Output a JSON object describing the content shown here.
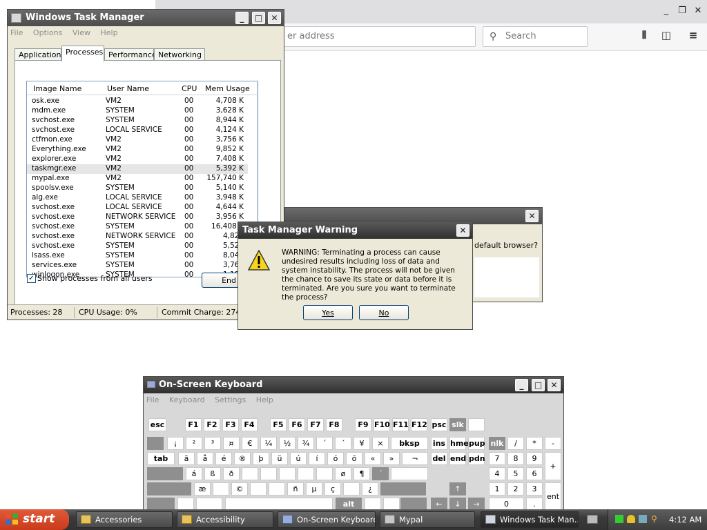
{
  "browser": {
    "url_placeholder": "er address",
    "search_placeholder": "Search"
  },
  "taskmanager": {
    "title": "Windows Task Manager",
    "menu": [
      "File",
      "Options",
      "View",
      "Help"
    ],
    "tabs": [
      "Applications",
      "Processes",
      "Performance",
      "Networking"
    ],
    "selected_tab": "Processes",
    "columns": [
      "Image Name",
      "User Name",
      "CPU",
      "Mem Usage"
    ],
    "processes": [
      [
        "osk.exe",
        "VM2",
        "00",
        "4,708 K"
      ],
      [
        "mdm.exe",
        "SYSTEM",
        "00",
        "3,628 K"
      ],
      [
        "svchost.exe",
        "SYSTEM",
        "00",
        "8,944 K"
      ],
      [
        "svchost.exe",
        "LOCAL SERVICE",
        "00",
        "4,124 K"
      ],
      [
        "ctfmon.exe",
        "VM2",
        "00",
        "3,756 K"
      ],
      [
        "Everything.exe",
        "VM2",
        "00",
        "9,852 K"
      ],
      [
        "explorer.exe",
        "VM2",
        "00",
        "7,408 K"
      ],
      [
        "taskmgr.exe",
        "VM2",
        "00",
        "5,392 K"
      ],
      [
        "mypal.exe",
        "VM2",
        "00",
        "157,740 K"
      ],
      [
        "spoolsv.exe",
        "SYSTEM",
        "00",
        "5,140 K"
      ],
      [
        "alg.exe",
        "LOCAL SERVICE",
        "00",
        "3,948 K"
      ],
      [
        "svchost.exe",
        "LOCAL SERVICE",
        "00",
        "4,644 K"
      ],
      [
        "svchost.exe",
        "NETWORK SERVICE",
        "00",
        "3,956 K"
      ],
      [
        "svchost.exe",
        "SYSTEM",
        "00",
        "16,408 K"
      ],
      [
        "svchost.exe",
        "NETWORK SERVICE",
        "00",
        "4,820"
      ],
      [
        "svchost.exe",
        "SYSTEM",
        "00",
        "5,528"
      ],
      [
        "lsass.exe",
        "SYSTEM",
        "00",
        "8,040"
      ],
      [
        "services.exe",
        "SYSTEM",
        "00",
        "3,764"
      ],
      [
        "winlogon.exe",
        "SYSTEM",
        "00",
        "1,196"
      ]
    ],
    "show_all_label": "Show processes from all users",
    "show_all_checked": true,
    "end_process_label": "End Pro",
    "status": {
      "processes": "Processes: 28",
      "cpu": "CPU Usage: 0%",
      "commit": "Commit Charge: 274M /"
    }
  },
  "background_dialog": {
    "text": "default browser?"
  },
  "warning": {
    "title": "Task Manager Warning",
    "message": "WARNING: Terminating a process can cause undesired results including loss of data and system instability. The process will not be given the chance to save its state or data before it is terminated.  Are you sure you want to terminate the process?",
    "yes_label": "Yes",
    "no_label": "No"
  },
  "keyboard": {
    "title": "On-Screen Keyboard",
    "menu": [
      "File",
      "Keyboard",
      "Settings",
      "Help"
    ],
    "keys": [
      "esc",
      "F1",
      "F2",
      "F3",
      "F4",
      "F5",
      "F6",
      "F7",
      "F8",
      "F9",
      "F10",
      "F11",
      "F12",
      "psc",
      "slk",
      "",
      "",
      "¡",
      "²",
      "³",
      "¤",
      "€",
      "¼",
      "½",
      "¾",
      "´",
      "´",
      "¥",
      "×",
      "bksp",
      "ins",
      "hme",
      "pup",
      "nlk",
      "/",
      "*",
      "-",
      "tab",
      "ä",
      "å",
      "é",
      "®",
      "þ",
      "ü",
      "ú",
      "í",
      "ó",
      "ö",
      "«",
      "»",
      "¬",
      "del",
      "end",
      "pdn",
      "7",
      "8",
      "9",
      "+",
      "",
      "á",
      "ß",
      "ð",
      "",
      "",
      "",
      "",
      "",
      "ø",
      "¶",
      "´",
      "",
      "4",
      "5",
      "6",
      "",
      "æ",
      "",
      "©",
      "",
      "",
      "ñ",
      "µ",
      "ç",
      "",
      "¿",
      "",
      "↑",
      "1",
      "2",
      "3",
      "ent",
      "",
      "",
      "",
      "",
      "alt",
      "",
      "",
      "",
      "←",
      "↓",
      "→",
      "0",
      "."
    ]
  },
  "taskbar": {
    "start_label": "start",
    "tasks": [
      "Accessories",
      "Accessibility",
      "On-Screen Keyboard",
      "Mypal",
      "Windows Task Man..."
    ],
    "active_task": "Windows Task Man...",
    "clock": "4:12 AM"
  }
}
